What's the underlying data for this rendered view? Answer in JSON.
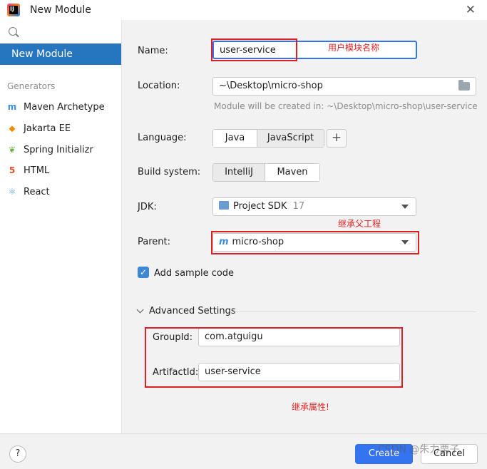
{
  "window": {
    "title": "New Module",
    "close_glyph": "✕",
    "app_icon_text": "IJ"
  },
  "sidebar": {
    "selected": "New Module",
    "generators_header": "Generators",
    "items": [
      {
        "label": "Maven Archetype",
        "icon": "maven-icon",
        "glyph": "m",
        "color": "#3b8fd9"
      },
      {
        "label": "Jakarta EE",
        "icon": "jakarta-icon",
        "glyph": "⬥",
        "color": "#f28b00"
      },
      {
        "label": "Spring Initializr",
        "icon": "spring-icon",
        "glyph": "❦",
        "color": "#6db33f"
      },
      {
        "label": "HTML",
        "icon": "html5-icon",
        "glyph": "5",
        "color": "#e44d26"
      },
      {
        "label": "React",
        "icon": "react-icon",
        "glyph": "⚛",
        "color": "#4fa6d3"
      }
    ]
  },
  "form": {
    "name_label": "Name:",
    "name_value": "user-service",
    "location_label": "Location:",
    "location_value": "~\\Desktop\\micro-shop",
    "location_hint": "Module will be created in: ~\\Desktop\\micro-shop\\user-service",
    "language_label": "Language:",
    "languages": [
      "Java",
      "JavaScript"
    ],
    "add_glyph": "+",
    "build_label": "Build system:",
    "build_systems": [
      "IntelliJ",
      "Maven"
    ],
    "jdk_label": "JDK:",
    "jdk_value": "Project SDK",
    "jdk_version": "17",
    "parent_label": "Parent:",
    "parent_value": "micro-shop",
    "sample_code_label": "Add sample code",
    "sample_code_checked": true,
    "advanced_label": "Advanced Settings",
    "groupid_label": "GroupId:",
    "groupid_value": "com.atguigu",
    "artifactid_label": "ArtifactId:",
    "artifactid_value": "user-service"
  },
  "annotations": {
    "name_note": "用户模块名称",
    "parent_note": "继承父工程",
    "props_note": "继承属性!",
    "color": "#e02020"
  },
  "buttons": {
    "help": "?",
    "create": "Create",
    "cancel": "Cancel"
  },
  "watermark": "CSDN @朱力栗子",
  "colors": {
    "accent": "#2675bf",
    "primary_button": "#3574f0"
  }
}
